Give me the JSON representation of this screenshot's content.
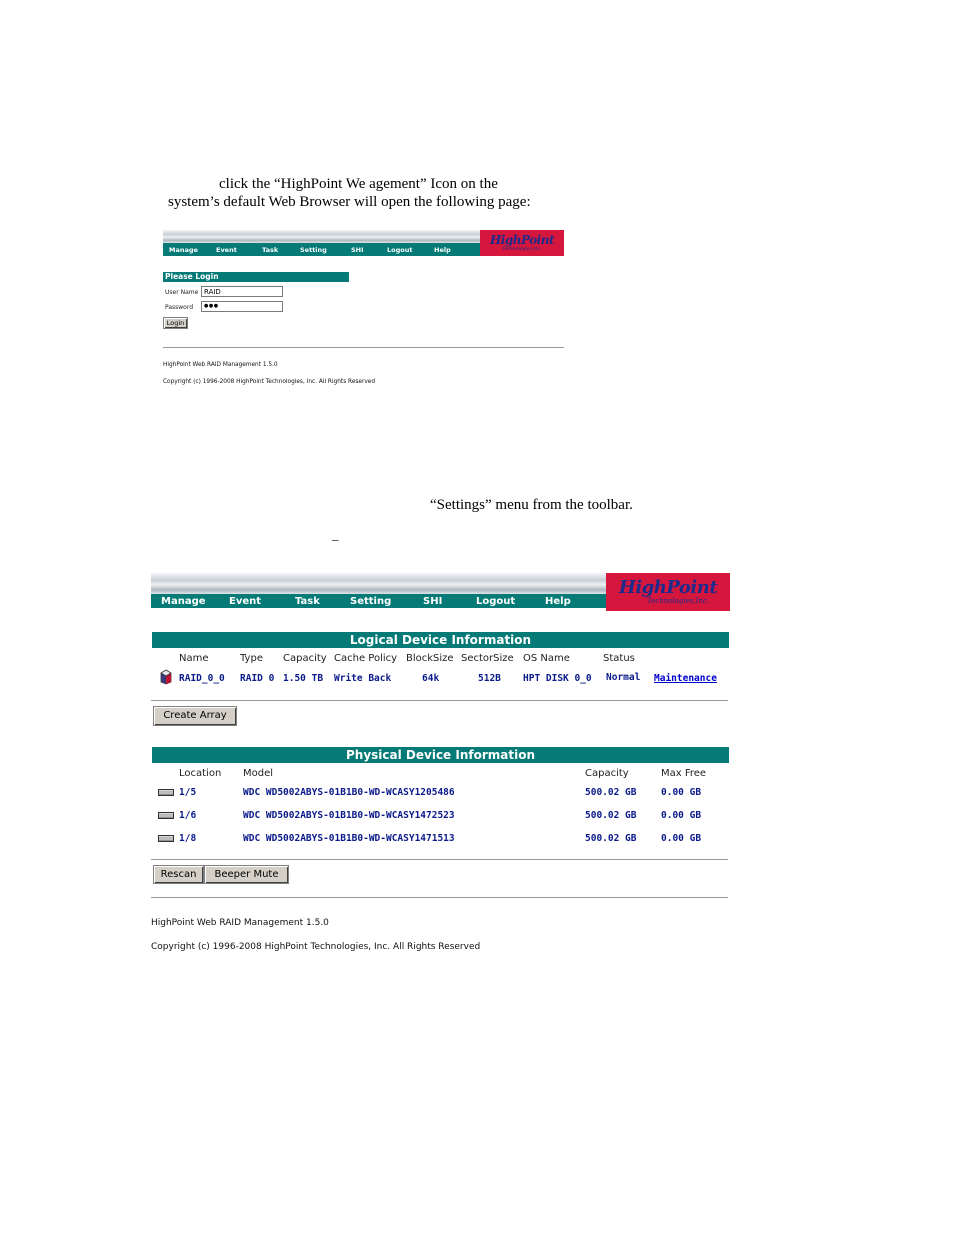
{
  "doc": {
    "line1": "click the “HighPoint We                      agement” Icon on the",
    "line2": "system’s default Web Browser will open the following page:",
    "line3": "“Settings” menu from the toolbar.",
    "line4": "_"
  },
  "toolbar": {
    "items": [
      "Manage",
      "Event",
      "Task",
      "Setting",
      "SHI",
      "Logout",
      "Help"
    ],
    "logo_main": "HighPoint",
    "logo_sub": "Technologies,Inc."
  },
  "login": {
    "heading": "Please Login",
    "username_label": "User Name",
    "username_value": "RAID",
    "password_label": "Password",
    "password_value": "●●●",
    "button": "Login"
  },
  "footer": {
    "version": "HighPoint Web RAID Management 1.5.0",
    "copyright": "Copyright (c) 1996-2008 HighPoint Technologies, Inc. All Rights Reserved"
  },
  "logical": {
    "heading": "Logical Device Information",
    "columns": [
      "Name",
      "Type",
      "Capacity",
      "Cache Policy",
      "BlockSize",
      "SectorSize",
      "OS Name",
      "Status"
    ],
    "rows": [
      {
        "name": "RAID_0_0",
        "type": "RAID 0",
        "capacity": "1.50 TB",
        "cache_policy": "Write Back",
        "block_size": "64k",
        "sector_size": "512B",
        "os_name": "HPT DISK 0_0",
        "status": "Normal",
        "action": "Maintenance"
      }
    ],
    "create_button": "Create Array"
  },
  "physical": {
    "heading": "Physical Device Information",
    "columns": [
      "Location",
      "Model",
      "Capacity",
      "Max Free"
    ],
    "rows": [
      {
        "location": "1/5",
        "model": "WDC WD5002ABYS-01B1B0-WD-WCASY1205486",
        "capacity": "500.02 GB",
        "max_free": "0.00 GB"
      },
      {
        "location": "1/6",
        "model": "WDC WD5002ABYS-01B1B0-WD-WCASY1472523",
        "capacity": "500.02 GB",
        "max_free": "0.00 GB"
      },
      {
        "location": "1/8",
        "model": "WDC WD5002ABYS-01B1B0-WD-WCASY1471513",
        "capacity": "500.02 GB",
        "max_free": "0.00 GB"
      }
    ],
    "rescan_button": "Rescan",
    "beeper_button": "Beeper Mute"
  },
  "colors": {
    "teal": "#057a77",
    "logo_red": "#d6173d",
    "logo_blue": "#1c2a8c",
    "link_navy": "#0b1a8a"
  }
}
